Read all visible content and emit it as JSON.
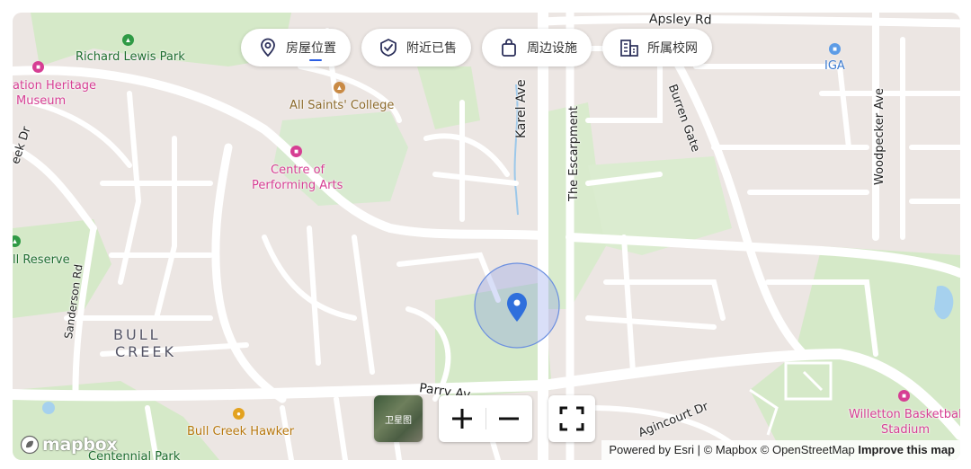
{
  "tabs": [
    {
      "label": "房屋位置",
      "icon": "location-pin-icon",
      "active": true
    },
    {
      "label": "附近已售",
      "icon": "check-shield-icon",
      "active": false
    },
    {
      "label": "周边设施",
      "icon": "shopping-bag-icon",
      "active": false
    },
    {
      "label": "所属校网",
      "icon": "school-building-icon",
      "active": false
    }
  ],
  "streets": {
    "apsley": "Apsley Rd",
    "karel": "Karel Ave",
    "escarpment": "The Escarpment",
    "burren": "Burren Gate",
    "woodpecker": "Woodpecker Ave",
    "sanderson": "Sanderson Rd",
    "parry": "Parry Av",
    "agincourt": "Agincourt Dr",
    "creek": "eek Dr"
  },
  "places": {
    "richard_lewis_park": "Richard Lewis Park",
    "heritage_line1": "ation Heritage",
    "heritage_line2": "Museum",
    "all_saints": "All Saints' College",
    "centre_line1": "Centre of",
    "centre_line2": "Performing Arts",
    "iga": "IGA",
    "reserve": "ll Reserve",
    "suburb_line1": "BULL",
    "suburb_line2": "CREEK",
    "hawker": "Bull Creek Hawker",
    "centennial": "Centennial Park",
    "willetton_line1": "Willetton Basketball",
    "willetton_line2": "Stadium"
  },
  "controls": {
    "satellite_label": "卫星图",
    "zoom_in": "zoom-in-icon",
    "zoom_out": "zoom-out-icon",
    "fullscreen": "fullscreen-icon"
  },
  "attribution": {
    "powered": "Powered by Esri",
    "sep": "|",
    "mapbox": "© Mapbox",
    "osm": "© OpenStreetMap",
    "improve": "Improve this map"
  },
  "logo_text": "mapbox",
  "colors": {
    "land": "#ece6e3",
    "park": "#d5e9c8",
    "road": "#ffffff",
    "water": "#a6d1ee",
    "marker": "#2f6fdc",
    "accent": "#2c5fe3"
  }
}
